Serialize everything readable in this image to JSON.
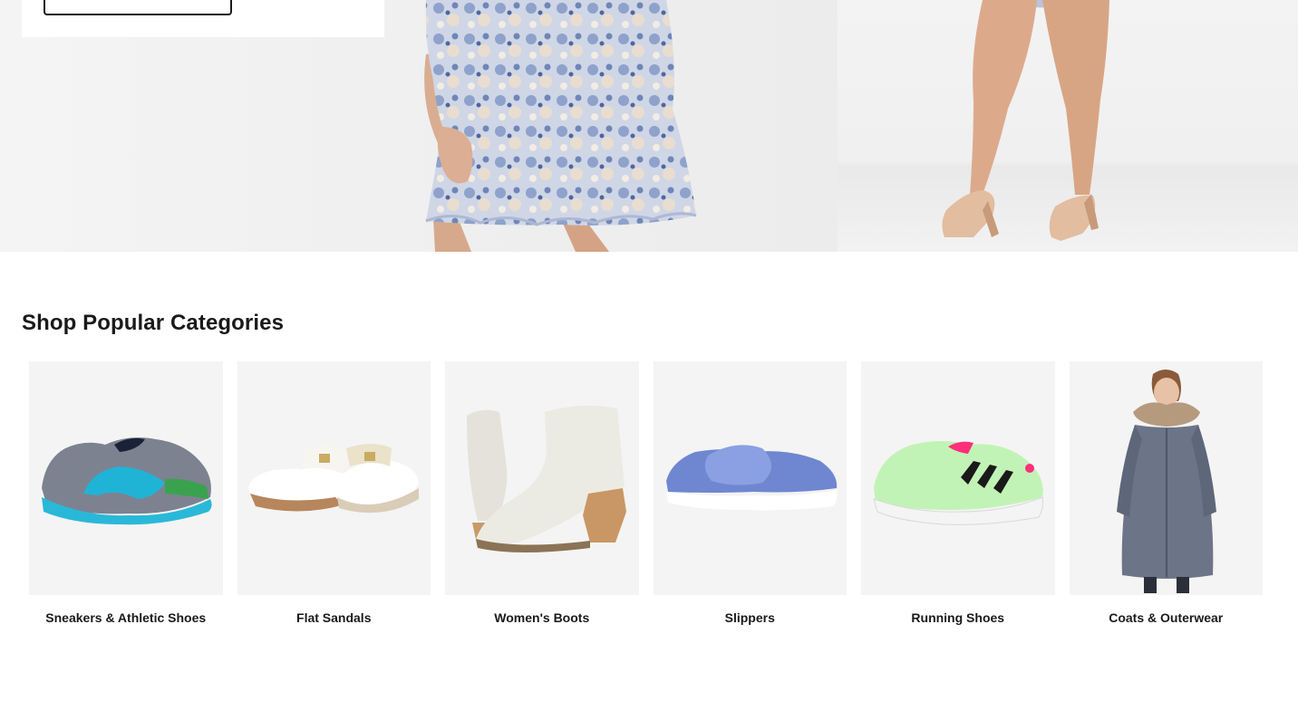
{
  "hero": {
    "promo_button_label": "",
    "left_image": "floral-wrap-dress-photo",
    "right_image": "model-legs-nude-heels-photo"
  },
  "categories": {
    "title": "Shop Popular Categories",
    "items": [
      {
        "label": "Sneakers & Athletic Shoes",
        "icon": "sneaker-icon"
      },
      {
        "label": "Flat Sandals",
        "icon": "sandal-icon"
      },
      {
        "label": "Women's Boots",
        "icon": "boot-icon"
      },
      {
        "label": "Slippers",
        "icon": "slipper-icon"
      },
      {
        "label": "Running Shoes",
        "icon": "running-shoe-icon"
      },
      {
        "label": "Coats & Outerwear",
        "icon": "coat-icon"
      }
    ]
  },
  "colors": {
    "tile_background": "#f4f4f4",
    "text": "#1a1a1a"
  }
}
